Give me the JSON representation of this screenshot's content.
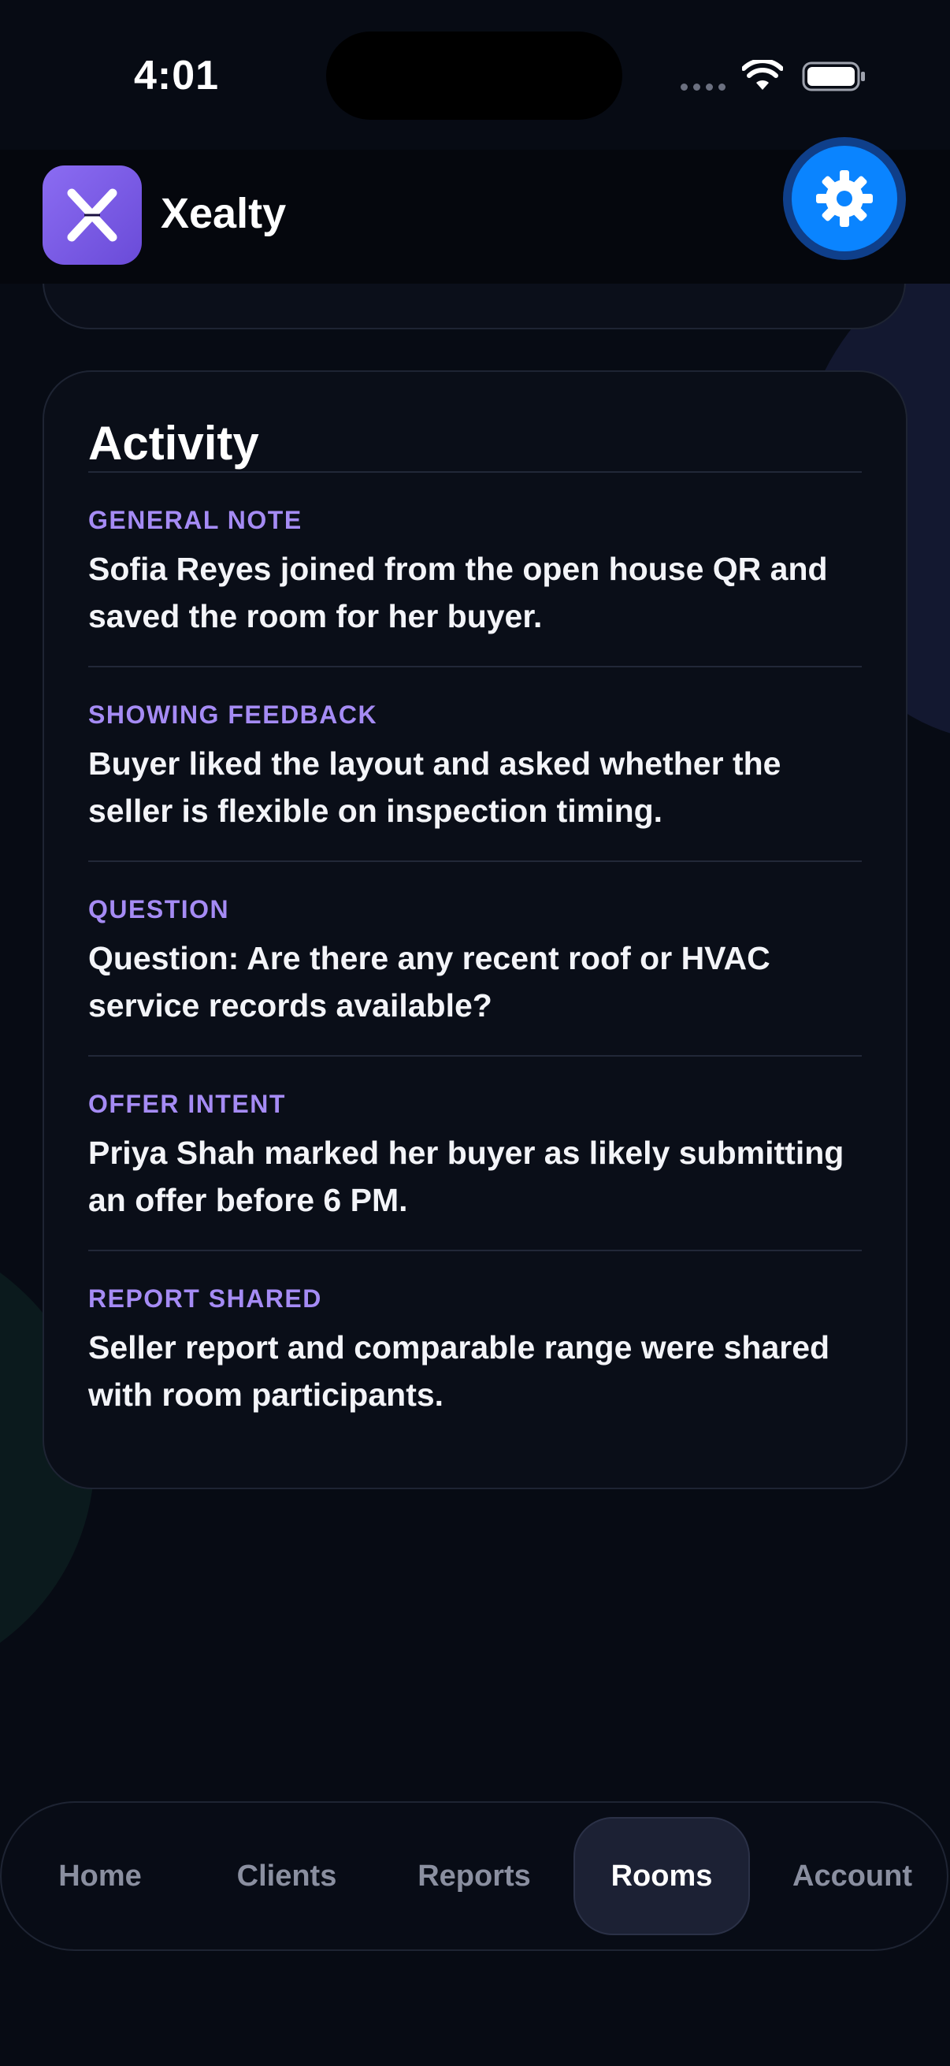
{
  "status_bar": {
    "time": "4:01"
  },
  "header": {
    "app_name": "Xealty",
    "logo_icon": "x-logo-icon",
    "settings_icon": "gear-icon",
    "brand_color": "#7b5ce6",
    "settings_color": "#0a84ff"
  },
  "activity": {
    "title": "Activity",
    "items": [
      {
        "tag": "GENERAL NOTE",
        "text": "Sofia Reyes joined from the open house QR and saved the room for her buyer."
      },
      {
        "tag": "SHOWING FEEDBACK",
        "text": "Buyer liked the layout and asked whether the seller is flexible on inspection timing."
      },
      {
        "tag": "QUESTION",
        "text": "Question: Are there any recent roof or HVAC service records available?"
      },
      {
        "tag": "OFFER INTENT",
        "text": "Priya Shah marked her buyer as likely submitting an offer before 6 PM."
      },
      {
        "tag": "REPORT SHARED",
        "text": "Seller report and comparable range were shared with room participants."
      }
    ],
    "tag_color": "#a58bf4"
  },
  "tab_bar": {
    "tabs": [
      {
        "label": "Home"
      },
      {
        "label": "Clients"
      },
      {
        "label": "Reports"
      },
      {
        "label": "Rooms"
      },
      {
        "label": "Account"
      }
    ],
    "active": "Rooms"
  }
}
